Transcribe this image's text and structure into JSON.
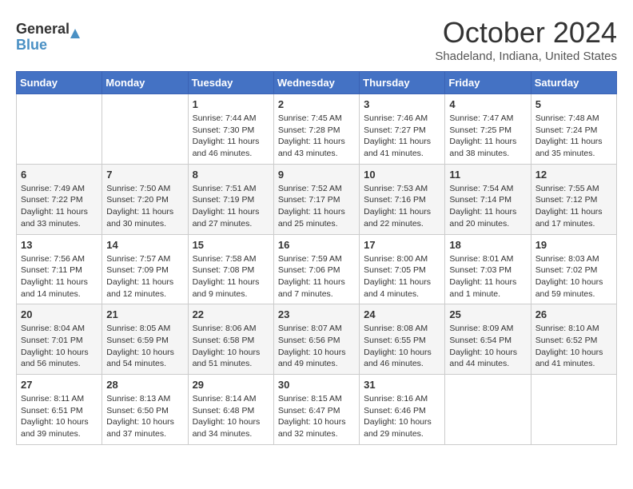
{
  "header": {
    "logo_line1": "General",
    "logo_line2": "Blue",
    "month_title": "October 2024",
    "location": "Shadeland, Indiana, United States"
  },
  "weekdays": [
    "Sunday",
    "Monday",
    "Tuesday",
    "Wednesday",
    "Thursday",
    "Friday",
    "Saturday"
  ],
  "weeks": [
    [
      {
        "day": "",
        "info": ""
      },
      {
        "day": "",
        "info": ""
      },
      {
        "day": "1",
        "info": "Sunrise: 7:44 AM\nSunset: 7:30 PM\nDaylight: 11 hours and 46 minutes."
      },
      {
        "day": "2",
        "info": "Sunrise: 7:45 AM\nSunset: 7:28 PM\nDaylight: 11 hours and 43 minutes."
      },
      {
        "day": "3",
        "info": "Sunrise: 7:46 AM\nSunset: 7:27 PM\nDaylight: 11 hours and 41 minutes."
      },
      {
        "day": "4",
        "info": "Sunrise: 7:47 AM\nSunset: 7:25 PM\nDaylight: 11 hours and 38 minutes."
      },
      {
        "day": "5",
        "info": "Sunrise: 7:48 AM\nSunset: 7:24 PM\nDaylight: 11 hours and 35 minutes."
      }
    ],
    [
      {
        "day": "6",
        "info": "Sunrise: 7:49 AM\nSunset: 7:22 PM\nDaylight: 11 hours and 33 minutes."
      },
      {
        "day": "7",
        "info": "Sunrise: 7:50 AM\nSunset: 7:20 PM\nDaylight: 11 hours and 30 minutes."
      },
      {
        "day": "8",
        "info": "Sunrise: 7:51 AM\nSunset: 7:19 PM\nDaylight: 11 hours and 27 minutes."
      },
      {
        "day": "9",
        "info": "Sunrise: 7:52 AM\nSunset: 7:17 PM\nDaylight: 11 hours and 25 minutes."
      },
      {
        "day": "10",
        "info": "Sunrise: 7:53 AM\nSunset: 7:16 PM\nDaylight: 11 hours and 22 minutes."
      },
      {
        "day": "11",
        "info": "Sunrise: 7:54 AM\nSunset: 7:14 PM\nDaylight: 11 hours and 20 minutes."
      },
      {
        "day": "12",
        "info": "Sunrise: 7:55 AM\nSunset: 7:12 PM\nDaylight: 11 hours and 17 minutes."
      }
    ],
    [
      {
        "day": "13",
        "info": "Sunrise: 7:56 AM\nSunset: 7:11 PM\nDaylight: 11 hours and 14 minutes."
      },
      {
        "day": "14",
        "info": "Sunrise: 7:57 AM\nSunset: 7:09 PM\nDaylight: 11 hours and 12 minutes."
      },
      {
        "day": "15",
        "info": "Sunrise: 7:58 AM\nSunset: 7:08 PM\nDaylight: 11 hours and 9 minutes."
      },
      {
        "day": "16",
        "info": "Sunrise: 7:59 AM\nSunset: 7:06 PM\nDaylight: 11 hours and 7 minutes."
      },
      {
        "day": "17",
        "info": "Sunrise: 8:00 AM\nSunset: 7:05 PM\nDaylight: 11 hours and 4 minutes."
      },
      {
        "day": "18",
        "info": "Sunrise: 8:01 AM\nSunset: 7:03 PM\nDaylight: 11 hours and 1 minute."
      },
      {
        "day": "19",
        "info": "Sunrise: 8:03 AM\nSunset: 7:02 PM\nDaylight: 10 hours and 59 minutes."
      }
    ],
    [
      {
        "day": "20",
        "info": "Sunrise: 8:04 AM\nSunset: 7:01 PM\nDaylight: 10 hours and 56 minutes."
      },
      {
        "day": "21",
        "info": "Sunrise: 8:05 AM\nSunset: 6:59 PM\nDaylight: 10 hours and 54 minutes."
      },
      {
        "day": "22",
        "info": "Sunrise: 8:06 AM\nSunset: 6:58 PM\nDaylight: 10 hours and 51 minutes."
      },
      {
        "day": "23",
        "info": "Sunrise: 8:07 AM\nSunset: 6:56 PM\nDaylight: 10 hours and 49 minutes."
      },
      {
        "day": "24",
        "info": "Sunrise: 8:08 AM\nSunset: 6:55 PM\nDaylight: 10 hours and 46 minutes."
      },
      {
        "day": "25",
        "info": "Sunrise: 8:09 AM\nSunset: 6:54 PM\nDaylight: 10 hours and 44 minutes."
      },
      {
        "day": "26",
        "info": "Sunrise: 8:10 AM\nSunset: 6:52 PM\nDaylight: 10 hours and 41 minutes."
      }
    ],
    [
      {
        "day": "27",
        "info": "Sunrise: 8:11 AM\nSunset: 6:51 PM\nDaylight: 10 hours and 39 minutes."
      },
      {
        "day": "28",
        "info": "Sunrise: 8:13 AM\nSunset: 6:50 PM\nDaylight: 10 hours and 37 minutes."
      },
      {
        "day": "29",
        "info": "Sunrise: 8:14 AM\nSunset: 6:48 PM\nDaylight: 10 hours and 34 minutes."
      },
      {
        "day": "30",
        "info": "Sunrise: 8:15 AM\nSunset: 6:47 PM\nDaylight: 10 hours and 32 minutes."
      },
      {
        "day": "31",
        "info": "Sunrise: 8:16 AM\nSunset: 6:46 PM\nDaylight: 10 hours and 29 minutes."
      },
      {
        "day": "",
        "info": ""
      },
      {
        "day": "",
        "info": ""
      }
    ]
  ]
}
